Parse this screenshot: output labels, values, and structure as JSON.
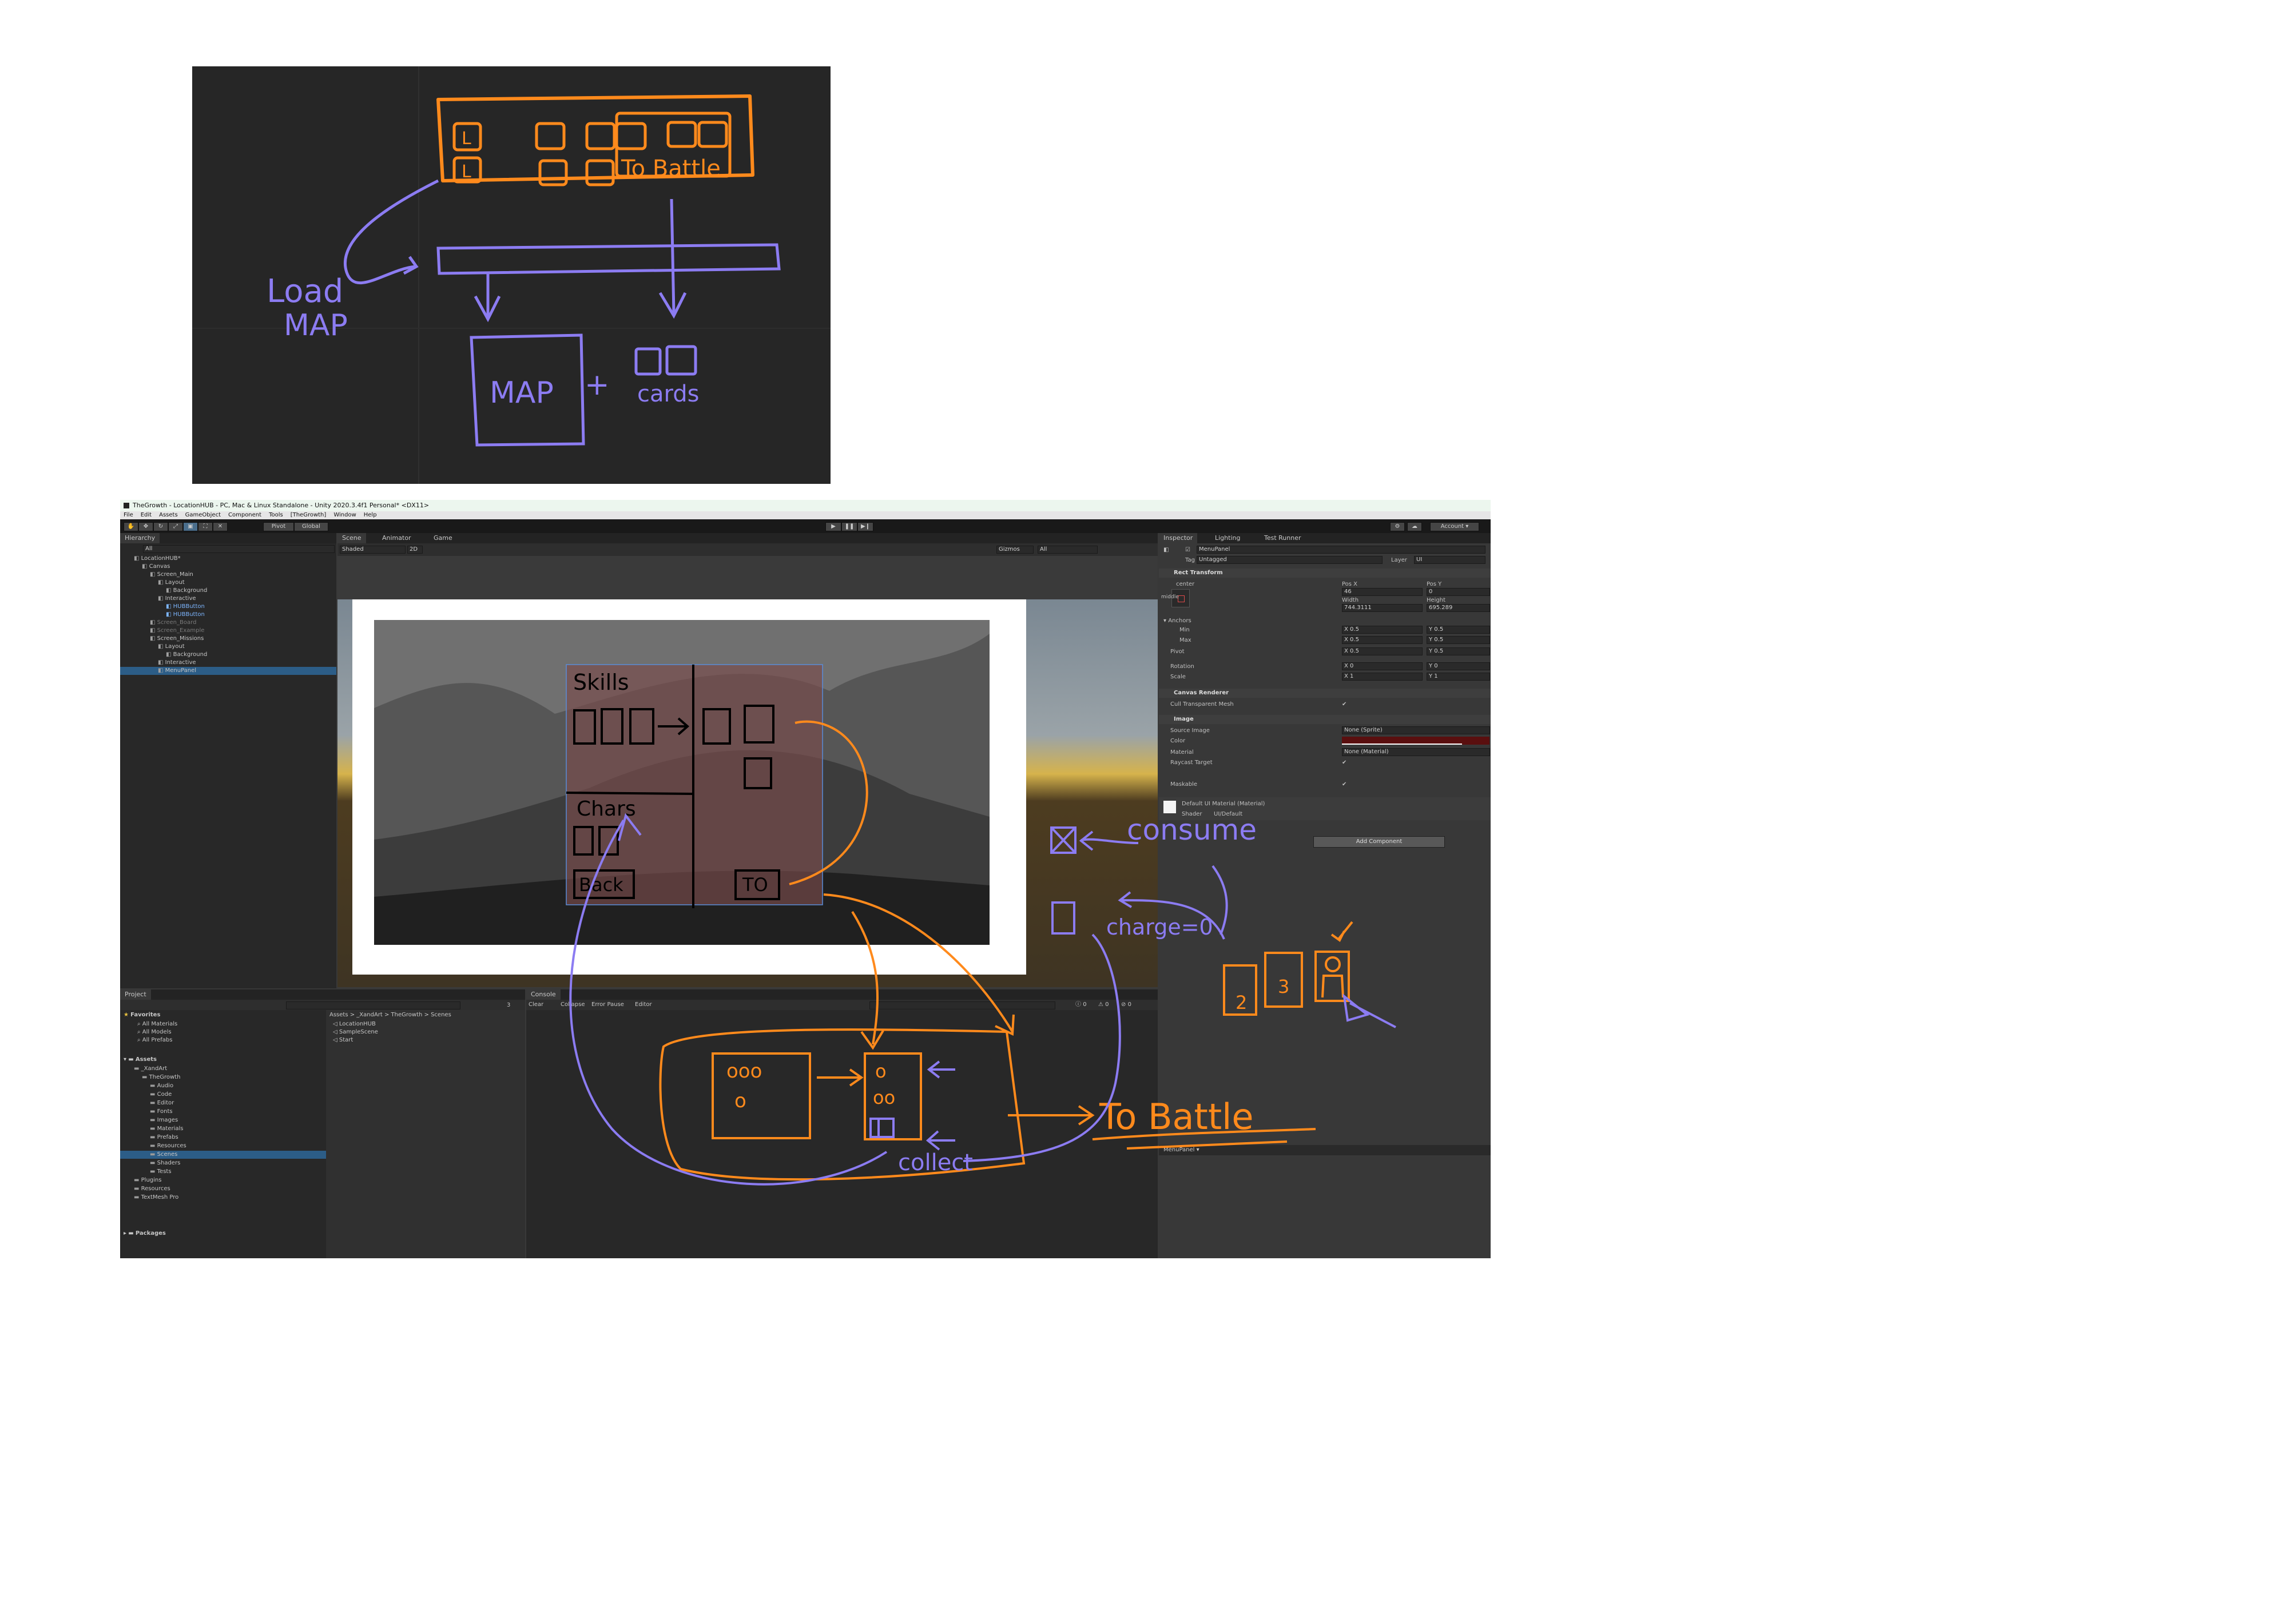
{
  "sketch": {
    "label_load": "Load",
    "label_map_upper": "MAP",
    "label_to_battle": "To Battle",
    "label_map": "MAP",
    "label_plus": "+",
    "label_cards": "cards",
    "box_mark": "L"
  },
  "window": {
    "title": "TheGrowth - LocationHUB - PC, Mac & Linux Standalone - Unity 2020.3.4f1 Personal* <DX11>"
  },
  "menu": [
    "File",
    "Edit",
    "Assets",
    "GameObject",
    "Component",
    "Tools",
    "[TheGrowth]",
    "Window",
    "Help"
  ],
  "toolbar": {
    "pivot": "Pivot",
    "global": "Global",
    "account": "Account"
  },
  "hierarchy": {
    "tab": "Hierarchy",
    "search_placeholder": "All",
    "items": [
      {
        "label": "LocationHUB*",
        "depth": 0
      },
      {
        "label": "Canvas",
        "depth": 1
      },
      {
        "label": "Screen_Main",
        "depth": 2
      },
      {
        "label": "Layout",
        "depth": 3
      },
      {
        "label": "Background",
        "depth": 4
      },
      {
        "label": "Interactive",
        "depth": 3
      },
      {
        "label": "HUBButton",
        "depth": 4,
        "style": "blue"
      },
      {
        "label": "HUBButton",
        "depth": 4,
        "style": "blue"
      },
      {
        "label": "Screen_Board",
        "depth": 2,
        "style": "dim"
      },
      {
        "label": "Screen_Example",
        "depth": 2,
        "style": "dim"
      },
      {
        "label": "Screen_Missions",
        "depth": 2
      },
      {
        "label": "Layout",
        "depth": 3
      },
      {
        "label": "Background",
        "depth": 4
      },
      {
        "label": "Interactive",
        "depth": 3
      },
      {
        "label": "MenuPanel",
        "depth": 3,
        "style": "sel"
      }
    ]
  },
  "scene": {
    "tabs": [
      "Scene",
      "Animator",
      "Game"
    ],
    "shading": "Shaded",
    "mode_2d": "2D",
    "gizmos": "Gizmos",
    "search_placeholder": "All",
    "sketch_skills": "Skills",
    "sketch_chars": "Chars",
    "sketch_back": "Back",
    "sketch_to": "TO"
  },
  "inspector": {
    "tabs": [
      "Inspector",
      "Lighting",
      "Test Runner"
    ],
    "object_name": "MenuPanel",
    "tag_label": "Tag",
    "tag_value": "Untagged",
    "layer_label": "Layer",
    "layer_value": "UI",
    "rect_transform": {
      "title": "Rect Transform",
      "anchor_label": "center",
      "side_label": "middle",
      "pos_x_label": "Pos X",
      "pos_x": "46",
      "pos_y_label": "Pos Y",
      "pos_y": "0",
      "width_label": "Width",
      "width": "744.3111",
      "height_label": "Height",
      "height": "695.289",
      "anchors_label": "Anchors",
      "min_label": "Min",
      "min_x": "X 0.5",
      "min_y": "Y 0.5",
      "max_label": "Max",
      "max_x": "X 0.5",
      "max_y": "Y 0.5",
      "pivot_label": "Pivot",
      "pivot_x": "X 0.5",
      "pivot_y": "Y 0.5",
      "rotation_label": "Rotation",
      "rotation_x": "X 0",
      "rotation_y": "Y 0",
      "scale_label": "Scale",
      "scale_x": "X 1",
      "scale_y": "Y 1"
    },
    "canvas_renderer": {
      "title": "Canvas Renderer",
      "cull_label": "Cull Transparent Mesh"
    },
    "image": {
      "title": "Image",
      "source_label": "Source Image",
      "source_value": "None (Sprite)",
      "color_label": "Color",
      "material_label": "Material",
      "material_value": "None (Material)",
      "raycast_label": "Raycast Target",
      "maskable_label": "Maskable"
    },
    "material_preview": {
      "name": "Default UI Material (Material)",
      "shader_label": "Shader",
      "shader_value": "UI/Default"
    },
    "add_component": "Add Component",
    "preview_bar": "MenuPanel ▾"
  },
  "project": {
    "tab": "Project",
    "favorites_label": "Favorites",
    "favorites": [
      "All Materials",
      "All Models",
      "All Prefabs"
    ],
    "assets_label": "Assets",
    "tree": [
      {
        "label": "_XandArt",
        "depth": 1
      },
      {
        "label": "TheGrowth",
        "depth": 2
      },
      {
        "label": "Audio",
        "depth": 3
      },
      {
        "label": "Code",
        "depth": 3
      },
      {
        "label": "Editor",
        "depth": 3
      },
      {
        "label": "Fonts",
        "depth": 3
      },
      {
        "label": "Images",
        "depth": 3
      },
      {
        "label": "Materials",
        "depth": 3
      },
      {
        "label": "Prefabs",
        "depth": 3
      },
      {
        "label": "Resources",
        "depth": 3
      },
      {
        "label": "Scenes",
        "depth": 3,
        "style": "sel"
      },
      {
        "label": "Shaders",
        "depth": 3
      },
      {
        "label": "Tests",
        "depth": 3
      },
      {
        "label": "Plugins",
        "depth": 1
      },
      {
        "label": "Resources",
        "depth": 1
      },
      {
        "label": "TextMesh Pro",
        "depth": 1
      }
    ],
    "packages_label": "Packages",
    "breadcrumb": "Assets > _XandArt > TheGrowth > Scenes",
    "files": [
      "LocationHUB",
      "SampleScene",
      "Start"
    ],
    "count": "3"
  },
  "console": {
    "tab": "Console",
    "buttons": [
      "Clear",
      "Collapse",
      "Error Pause",
      "Editor"
    ],
    "counts": [
      "0",
      "0",
      "0"
    ]
  },
  "annotations": {
    "consume": "consume",
    "charge": "charge=0",
    "to_battle": "To Battle",
    "collect": "collect",
    "card_2": "2",
    "card_3": "3"
  },
  "colors": {
    "orange": "#ff8a1c",
    "purple": "#8c7cf2",
    "selection": "#2c5d87"
  }
}
